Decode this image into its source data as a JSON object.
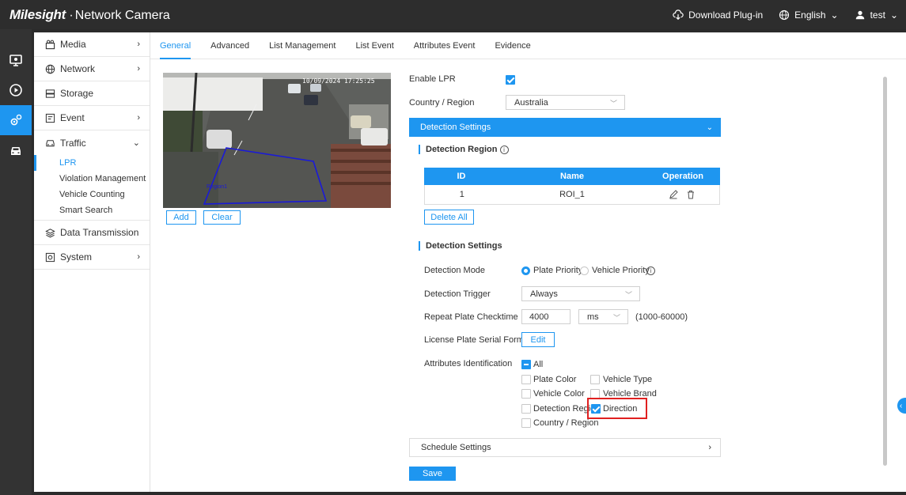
{
  "header": {
    "brand": "Milesight",
    "product": "Network Camera",
    "download_label": "Download Plug-in",
    "language_label": "English",
    "user_label": "test"
  },
  "rail": [
    "live-view-icon",
    "playback-icon",
    "settings-icon",
    "vehicle-icon"
  ],
  "sidebar": {
    "items": [
      {
        "label": "Media",
        "icon": "media-icon",
        "expandable": true
      },
      {
        "label": "Network",
        "icon": "globe-icon",
        "expandable": true
      },
      {
        "label": "Storage",
        "icon": "storage-icon",
        "expandable": false
      },
      {
        "label": "Event",
        "icon": "event-icon",
        "expandable": true
      },
      {
        "label": "Traffic",
        "icon": "car-icon",
        "expandable": true
      }
    ],
    "traffic_sub": [
      "LPR",
      "Violation Management",
      "Vehicle Counting",
      "Smart Search"
    ],
    "bottom_items": [
      {
        "label": "Data Transmission",
        "icon": "layers-icon"
      },
      {
        "label": "System",
        "icon": "system-icon"
      }
    ]
  },
  "tabs": [
    "General",
    "Advanced",
    "List Management",
    "List Event",
    "Attributes Event",
    "Evidence"
  ],
  "video": {
    "timestamp": "10/09/2024 17:25:25",
    "region_label": "Region1",
    "add_label": "Add",
    "clear_label": "Clear"
  },
  "form": {
    "enable_lpr_label": "Enable LPR",
    "enable_lpr": true,
    "country_label": "Country / Region",
    "country_value": "Australia",
    "detection_settings_header": "Detection Settings",
    "detection_region_title": "Detection Region",
    "table": {
      "headers": [
        "ID",
        "Name",
        "Operation"
      ],
      "rows": [
        {
          "id": "1",
          "name": "ROI_1"
        }
      ]
    },
    "delete_all_label": "Delete All",
    "detection_settings_title": "Detection Settings",
    "detection_mode_label": "Detection Mode",
    "mode_plate": "Plate Priority",
    "mode_vehicle": "Vehicle Priority",
    "detection_trigger_label": "Detection Trigger",
    "detection_trigger_value": "Always",
    "repeat_label": "Repeat Plate Checktime",
    "repeat_value": "4000",
    "repeat_unit": "ms",
    "repeat_range": "(1000-60000)",
    "serial_label": "License Plate Serial Format",
    "edit_label": "Edit",
    "attributes_label": "Attributes Identification",
    "attr_all": "All",
    "attr_plate_color": "Plate Color",
    "attr_vehicle_type": "Vehicle Type",
    "attr_vehicle_color": "Vehicle Color",
    "attr_vehicle_brand": "Vehicle Brand",
    "attr_detection_region": "Detection Region",
    "attr_direction": "Direction",
    "attr_country": "Country / Region",
    "schedule_label": "Schedule Settings",
    "save_label": "Save"
  },
  "colors": {
    "accent": "#1e96f0",
    "highlight": "#e02020",
    "topbar": "#2d2d2d"
  }
}
